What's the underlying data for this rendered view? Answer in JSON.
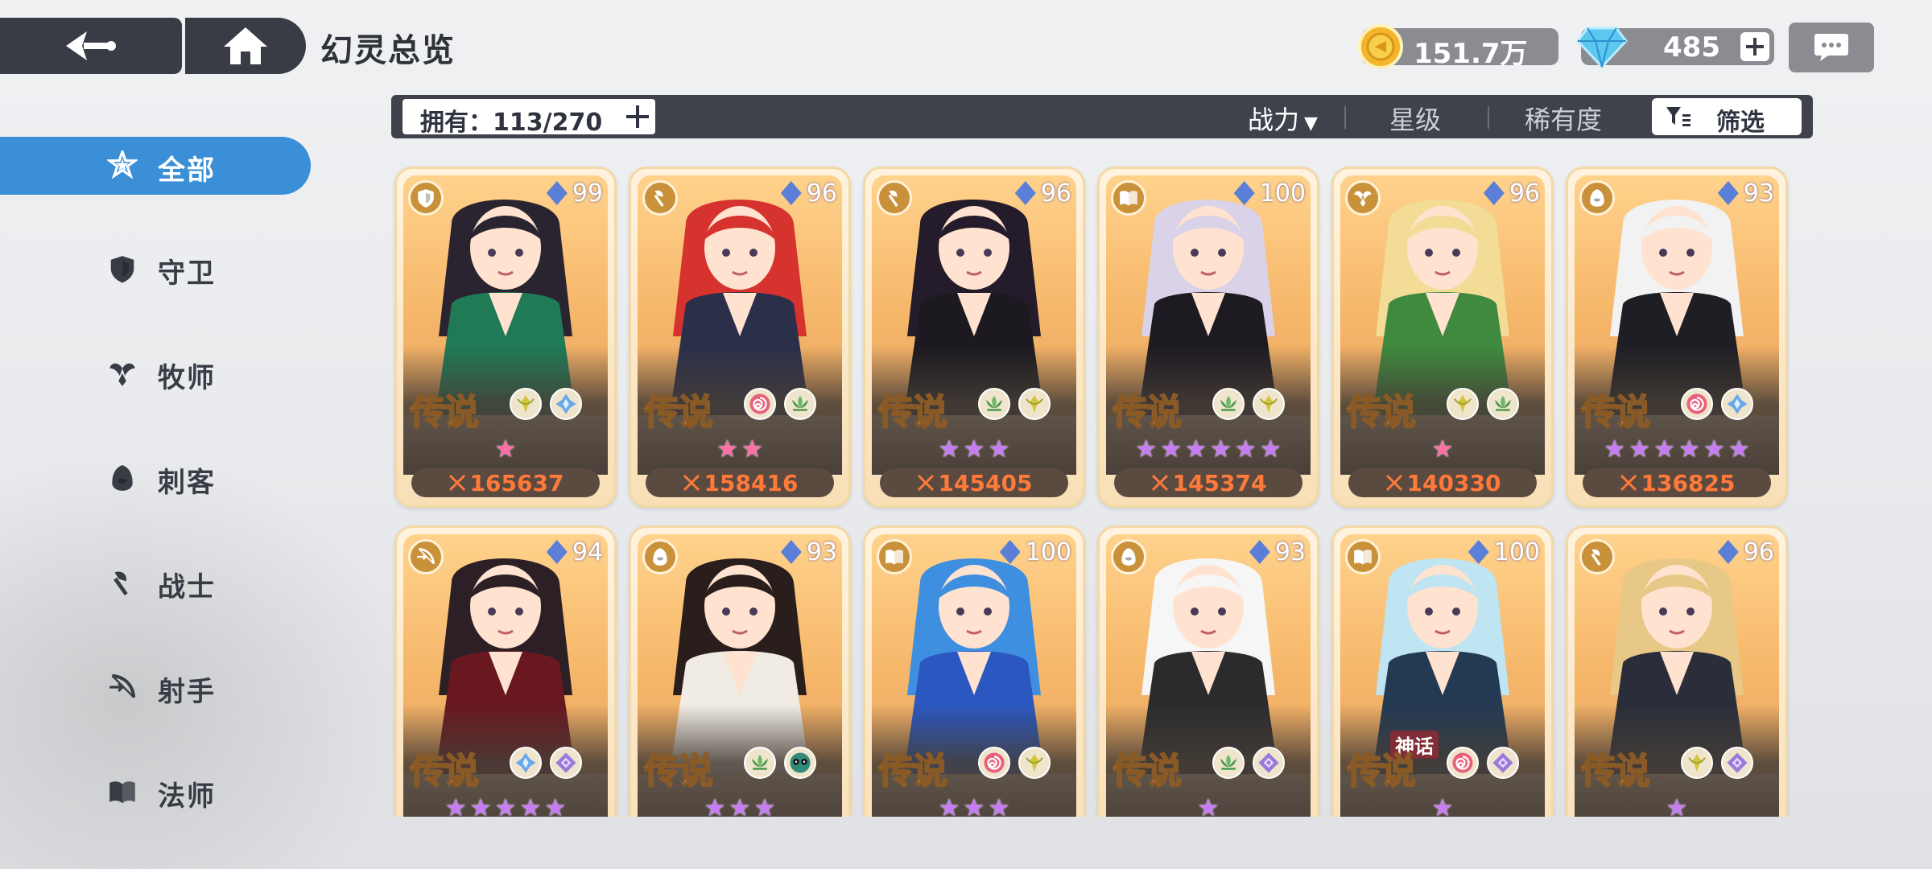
{
  "header": {
    "title": "幻灵总览",
    "gold": "151.7万",
    "gems": "485"
  },
  "sidebar": {
    "items": [
      {
        "label": "全部",
        "icon": "all-star-icon",
        "active": true
      },
      {
        "label": "守卫",
        "icon": "shield-icon",
        "active": false
      },
      {
        "label": "牧师",
        "icon": "priest-wings-icon",
        "active": false
      },
      {
        "label": "刺客",
        "icon": "assassin-hood-icon",
        "active": false
      },
      {
        "label": "战士",
        "icon": "axe-icon",
        "active": false
      },
      {
        "label": "射手",
        "icon": "bow-icon",
        "active": false
      },
      {
        "label": "法师",
        "icon": "book-icon",
        "active": false
      }
    ]
  },
  "filterbar": {
    "owned": "拥有：113/270",
    "sort_power": "战力",
    "sort_star": "星级",
    "sort_rarity": "稀有度",
    "filter": "筛选"
  },
  "colors": {
    "accent": "#3b8fd6",
    "bar": "#3f414b",
    "power": "#ff7a3a",
    "star_pink": "#ff6fa6",
    "star_purple": "#c77bf5"
  },
  "cards": [
    {
      "class_icon": "shield-icon",
      "level": "99",
      "rarity": "传说",
      "tags": [
        "wind-icon",
        "crystal-icon"
      ],
      "stars": 1,
      "star_color": "#ff6fa6",
      "power": "165637",
      "hair": "#2a2430",
      "outfit": "#1f7a55"
    },
    {
      "class_icon": "axe-icon",
      "level": "96",
      "rarity": "传说",
      "tags": [
        "spiral-icon",
        "lotus-icon"
      ],
      "stars": 2,
      "star_color": "#ff6fa6",
      "power": "158416",
      "hair": "#d6322e",
      "outfit": "#2b2f4a"
    },
    {
      "class_icon": "axe-icon",
      "level": "96",
      "rarity": "传说",
      "tags": [
        "lotus-icon",
        "wind-icon"
      ],
      "stars": 3,
      "star_color": "#c77bf5",
      "power": "145405",
      "hair": "#241c2a",
      "outfit": "#1c1a20"
    },
    {
      "class_icon": "book-icon",
      "level": "100",
      "rarity": "传说",
      "tags": [
        "lotus-icon",
        "wind-icon"
      ],
      "stars": 6,
      "star_color": "#c77bf5",
      "power": "145374",
      "hair": "#d9d2e8",
      "outfit": "#1e1a22"
    },
    {
      "class_icon": "priest-wings-icon",
      "level": "96",
      "rarity": "传说",
      "tags": [
        "wind-icon",
        "lotus-icon"
      ],
      "stars": 1,
      "star_color": "#ff6fa6",
      "power": "140330",
      "hair": "#f2dc96",
      "outfit": "#3f8a3f"
    },
    {
      "class_icon": "assassin-hood-icon",
      "level": "93",
      "rarity": "传说",
      "tags": [
        "spiral-icon",
        "crystal-icon"
      ],
      "stars": 6,
      "star_color": "#c77bf5",
      "power": "136825",
      "hair": "#f2f2f2",
      "outfit": "#1e1e24"
    },
    {
      "class_icon": "bow-icon",
      "level": "94",
      "rarity": "传说",
      "tags": [
        "crystal-icon",
        "gem-icon"
      ],
      "stars": 5,
      "star_color": "#c77bf5",
      "hair": "#2c2026",
      "outfit": "#6a1820"
    },
    {
      "class_icon": "assassin-hood-icon",
      "level": "93",
      "rarity": "传说",
      "tags": [
        "lotus-icon",
        "panda-icon"
      ],
      "stars": 3,
      "star_color": "#c77bf5",
      "hair": "#2a1e1c",
      "outfit": "#f0ece4"
    },
    {
      "class_icon": "book-icon",
      "level": "100",
      "rarity": "传说",
      "tags": [
        "spiral-icon",
        "wind-icon"
      ],
      "stars": 3,
      "star_color": "#c77bf5",
      "hair": "#3f8fe0",
      "outfit": "#2a57c0"
    },
    {
      "class_icon": "assassin-hood-icon",
      "level": "93",
      "rarity": "传说",
      "tags": [
        "lotus-icon",
        "gem-icon"
      ],
      "stars": 1,
      "star_color": "#c77bf5",
      "hair": "#f6f6f6",
      "outfit": "#2b2b2e"
    },
    {
      "class_icon": "book-icon",
      "level": "100",
      "rarity": "传说",
      "badge": "神话",
      "tags": [
        "spiral-icon",
        "gem-icon"
      ],
      "stars": 1,
      "star_color": "#c77bf5",
      "hair": "#bfe4f2",
      "outfit": "#243a52"
    },
    {
      "class_icon": "axe-icon",
      "level": "96",
      "rarity": "传说",
      "tags": [
        "wind-icon",
        "gem-icon"
      ],
      "stars": 1,
      "star_color": "#c77bf5",
      "hair": "#e8c886",
      "outfit": "#2b2e3a"
    }
  ]
}
